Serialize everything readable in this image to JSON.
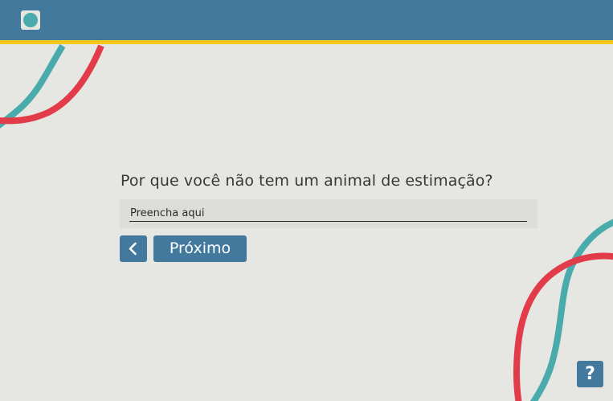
{
  "colors": {
    "header": "#44799e",
    "header_accent": "#f2c81c",
    "background": "#e6e6e2",
    "teal": "#4aabad",
    "red": "#e23c4b",
    "button": "#44799e",
    "input_bg": "#dcdcd9"
  },
  "header": {
    "logo_icon": "circle-logo-icon"
  },
  "form": {
    "question": "Por que você não tem um animal de estimação?",
    "input_value": "",
    "input_placeholder": "Preencha aqui"
  },
  "nav": {
    "back_icon": "chevron-left-icon",
    "next_label": "Próximo"
  },
  "help": {
    "label": "?"
  }
}
